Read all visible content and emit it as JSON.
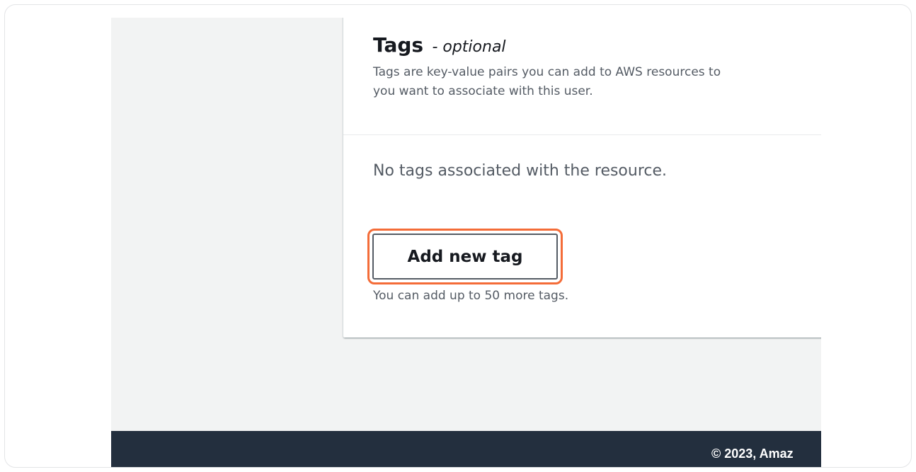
{
  "tags_section": {
    "title": "Tags",
    "title_suffix": "- optional",
    "description_line1": "Tags are key-value pairs you can add to AWS resources to",
    "description_line2": "you want to associate with this user.",
    "empty_message": "No tags associated with the resource.",
    "add_button_label": "Add new tag",
    "limit_hint": "You can add up to 50 more tags."
  },
  "footer": {
    "copyright": "© 2023, Amaz"
  },
  "colors": {
    "page_background": "#f2f3f3",
    "panel_background": "#ffffff",
    "footer_background": "#232f3e",
    "highlight": "#f46c38",
    "secondary_text": "#545b64",
    "primary_text": "#16191f"
  }
}
